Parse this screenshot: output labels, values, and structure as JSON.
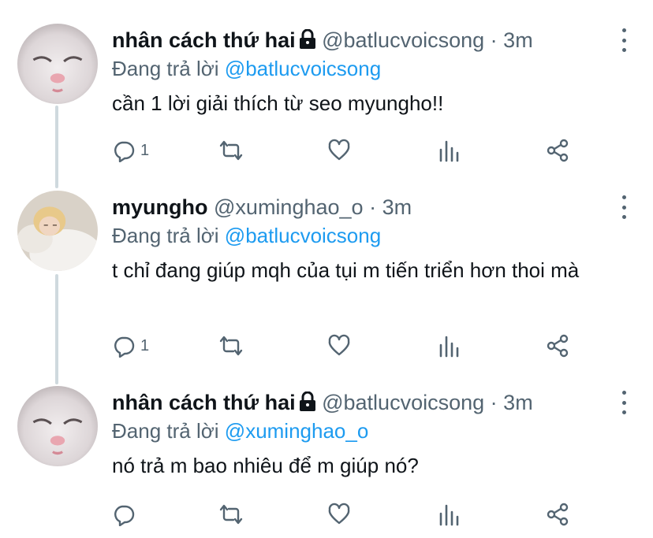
{
  "tweets": [
    {
      "author_name": "nhân cách thứ hai",
      "locked": true,
      "handle": "@batlucvoicsong",
      "separator": "·",
      "time": "3m",
      "reply_prefix": "Đang trả lời",
      "reply_to": "@batlucvoicsong",
      "text": "cần 1 lời giải thích từ seo myungho!!",
      "reply_count": "1"
    },
    {
      "author_name": "myungho",
      "locked": false,
      "handle": "@xuminghao_o",
      "separator": "·",
      "time": "3m",
      "reply_prefix": "Đang trả lời",
      "reply_to": "@batlucvoicsong",
      "text": "t chỉ đang giúp mqh của tụi m tiến triển hơn thoi mà",
      "reply_count": "1"
    },
    {
      "author_name": "nhân cách thứ hai",
      "locked": true,
      "handle": "@batlucvoicsong",
      "separator": "·",
      "time": "3m",
      "reply_prefix": "Đang trả lời",
      "reply_to": "@xuminghao_o",
      "text": "nó trả m bao nhiêu để m giúp nó?",
      "reply_count": ""
    }
  ],
  "icons": {
    "reply": "reply-icon",
    "retweet": "retweet-icon",
    "like": "heart-icon",
    "views": "views-icon",
    "share": "share-icon",
    "lock": "lock-icon",
    "more": "more-icon"
  },
  "colors": {
    "text": "#0f1419",
    "secondary": "#536471",
    "accent": "#1d9bf0",
    "thread_line": "#cfd9de"
  }
}
